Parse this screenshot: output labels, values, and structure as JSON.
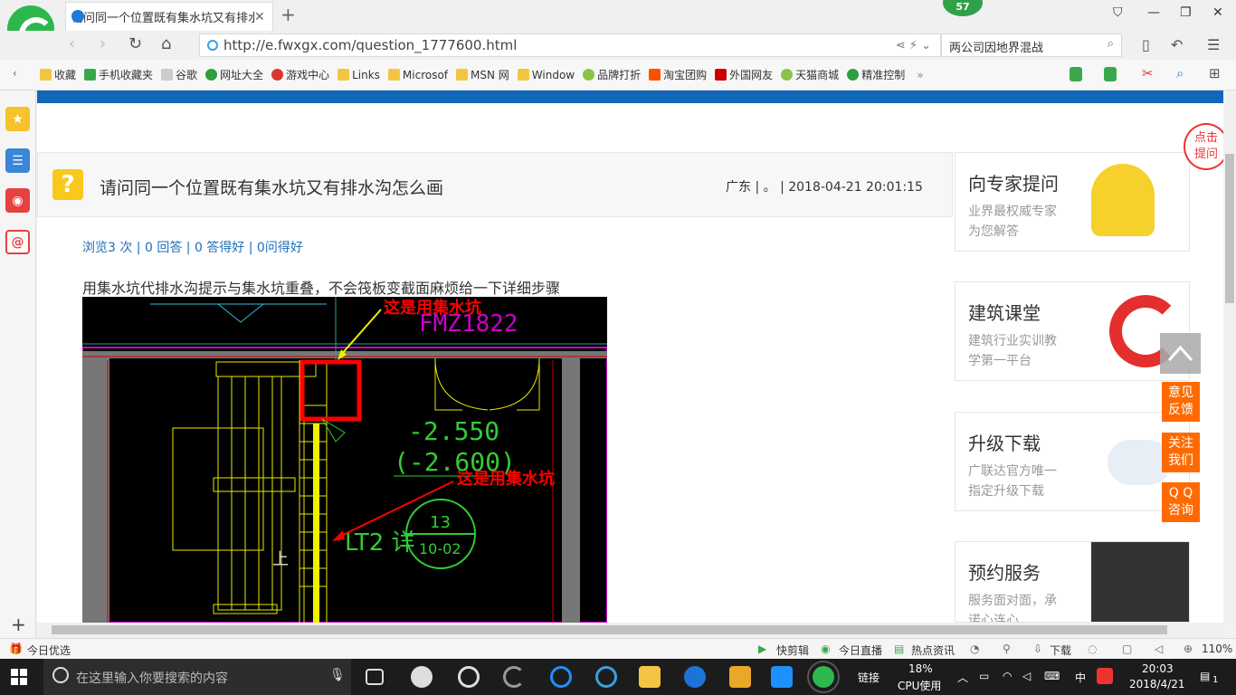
{
  "browser": {
    "tab_title": "请问同一个位置既有集水坑又有排水沟怎么画",
    "notification_badge": "57",
    "url": "http://e.fwxgx.com/question_1777600.html",
    "search_text": "两公司因地界混战"
  },
  "bookmarks": [
    {
      "label": "收藏",
      "icon": "star-icon",
      "color": "#f4c542"
    },
    {
      "label": "手机收藏夹",
      "icon": "phone-icon",
      "color": "#3aa84a"
    },
    {
      "label": "谷歌",
      "icon": "page-icon",
      "color": "#cccccc"
    },
    {
      "label": "网址大全",
      "icon": "globe-icon",
      "color": "#2e9e3e"
    },
    {
      "label": "游戏中心",
      "icon": "game-icon",
      "color": "#d33"
    },
    {
      "label": "Links",
      "icon": "folder-icon",
      "color": "#f4c542"
    },
    {
      "label": "Microsof",
      "icon": "folder-icon",
      "color": "#f4c542"
    },
    {
      "label": "MSN 网",
      "icon": "folder-icon",
      "color": "#f4c542"
    },
    {
      "label": "Window",
      "icon": "folder-icon",
      "color": "#f4c542"
    },
    {
      "label": "品牌打折",
      "icon": "leaf-icon",
      "color": "#8bc34a"
    },
    {
      "label": "淘宝团购",
      "icon": "taobao-icon",
      "color": "#ff5000"
    },
    {
      "label": "外国网友",
      "icon": "bookmark-icon",
      "color": "#c00"
    },
    {
      "label": "天猫商城",
      "icon": "leaf-icon",
      "color": "#8bc34a"
    },
    {
      "label": "精准控制",
      "icon": "chat-icon",
      "color": "#2e9e3e"
    }
  ],
  "question": {
    "title": "请问同一个位置既有集水坑又有排水沟怎么画",
    "meta": "广东 | 。 | 2018-04-21 20:01:15",
    "stats": "浏览3 次 | 0 回答 | 0 答得好 | 0问得好",
    "body": "用集水坑代排水沟提示与集水坑重叠，不会筏板变截面麻烦给一下详细步骤",
    "image_annotations": {
      "top_label": "这是用集水坑",
      "mid_label": "这是用集水坑",
      "cad_tag": "FMZ1822",
      "elev1": "-2.550",
      "elev2": "(-2.600)",
      "lt_label": "LT2 详",
      "circle_top": "13",
      "circle_bottom": "10-02",
      "up_label": "上"
    }
  },
  "ads": [
    {
      "title": "向专家提问",
      "sub1": "业界最权威专家",
      "sub2": "为您解答"
    },
    {
      "title": "建筑课堂",
      "sub1": "建筑行业实训教",
      "sub2": "学第一平台"
    },
    {
      "title": "升级下载",
      "sub1": "广联达官方唯一",
      "sub2": "指定升级下载"
    },
    {
      "title": "预约服务",
      "sub1": "服务面对面，承",
      "sub2": "诺心连心"
    }
  ],
  "corner_badge": "点击\n提问",
  "float_buttons": [
    "意见\n反馈",
    "关注\n我们",
    "Q Q\n咨询"
  ],
  "statusbar": {
    "left": "今日优选",
    "kuaijian": "快剪辑",
    "live": "今日直播",
    "news": "热点资讯",
    "download": "下载",
    "zoom": "110%"
  },
  "taskbar": {
    "search_placeholder": "在这里输入你要搜索的内容",
    "links": "链接",
    "cpu_value": "18%",
    "cpu_label": "CPU使用",
    "ime": "中",
    "time": "20:03",
    "date": "2018/4/21",
    "notif_count": "1"
  }
}
